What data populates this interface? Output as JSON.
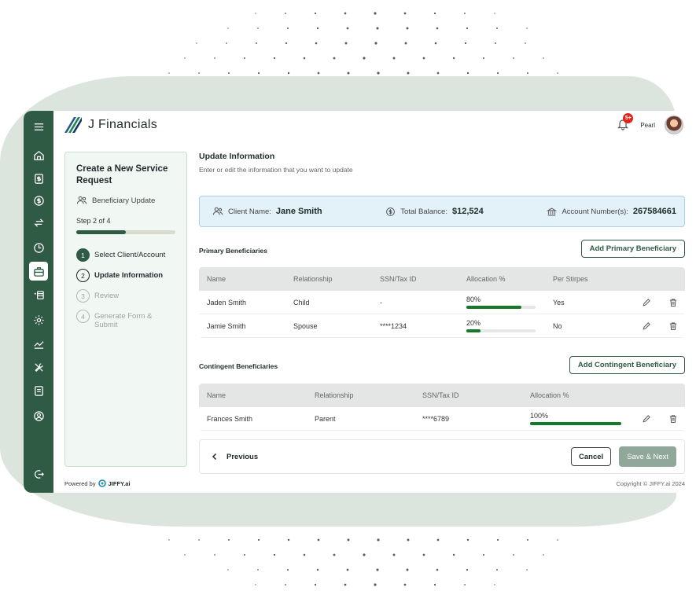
{
  "app": {
    "brand": "J Financials"
  },
  "topbar": {
    "notification_badge": "5+",
    "user_name": "Pearl"
  },
  "steps_panel": {
    "title": "Create a New Service Request",
    "subtitle": "Beneficiary Update",
    "step_count": "Step 2 of 4",
    "progress_fraction": 0.5,
    "steps": [
      {
        "num": "1",
        "label": "Select Client/Account",
        "state": "done"
      },
      {
        "num": "2",
        "label": "Update Information",
        "state": "current"
      },
      {
        "num": "3",
        "label": "Review",
        "state": "todo"
      },
      {
        "num": "4",
        "label": "Generate Form & Submit",
        "state": "todo"
      }
    ]
  },
  "main": {
    "title": "Update Information",
    "description": "Enter or edit the information that you want to update"
  },
  "client_info": {
    "client_label": "Client Name:",
    "client_value": "Jane Smith",
    "balance_label": "Total Balance:",
    "balance_value": "$12,524",
    "account_label": "Account Number(s):",
    "account_value": "267584661"
  },
  "primary": {
    "label": "Primary Beneficiaries",
    "add_button": "Add Primary Beneficiary",
    "headers": [
      "Name",
      "Relationship",
      "SSN/Tax ID",
      "Allocation %",
      "Per Stirpes"
    ],
    "rows": [
      {
        "name": "Jaden Smith",
        "relationship": "Child",
        "ssn": "-",
        "allocation": "80%",
        "allocation_fraction": 0.8,
        "per_stirpes": "Yes"
      },
      {
        "name": "Jamie Smith",
        "relationship": "Spouse",
        "ssn": "****1234",
        "allocation": "20%",
        "allocation_fraction": 0.2,
        "per_stirpes": "No"
      }
    ]
  },
  "contingent": {
    "label": "Contingent Beneficiaries",
    "add_button": "Add Contingent Beneficiary",
    "headers": [
      "Name",
      "Relationship",
      "SSN/Tax ID",
      "Allocation %"
    ],
    "rows": [
      {
        "name": "Frances Smith",
        "relationship": "Parent",
        "ssn": "****6789",
        "allocation": "100%",
        "allocation_fraction": 1.0
      }
    ]
  },
  "footer_actions": {
    "previous": "Previous",
    "cancel": "Cancel",
    "save_next": "Save & Next"
  },
  "footer": {
    "powered_by": "Powered by",
    "jiffy_logo": "JIFFY.ai",
    "copyright": "Copyright © JIFFY.ai 2024"
  },
  "colors": {
    "primary": "#2f5b45",
    "progress": "#137a2c",
    "badge": "#e0241b",
    "info_bg": "#e3f1f8"
  },
  "rail_icons": [
    "menu-icon",
    "home-icon",
    "document-dollar-icon",
    "dollar-circle-icon",
    "transfer-icon",
    "clock-icon",
    "briefcase-icon",
    "money-stack-icon",
    "settings-icon",
    "chart-icon",
    "tools-icon",
    "notes-icon",
    "account-circle-icon",
    "logout-icon"
  ]
}
